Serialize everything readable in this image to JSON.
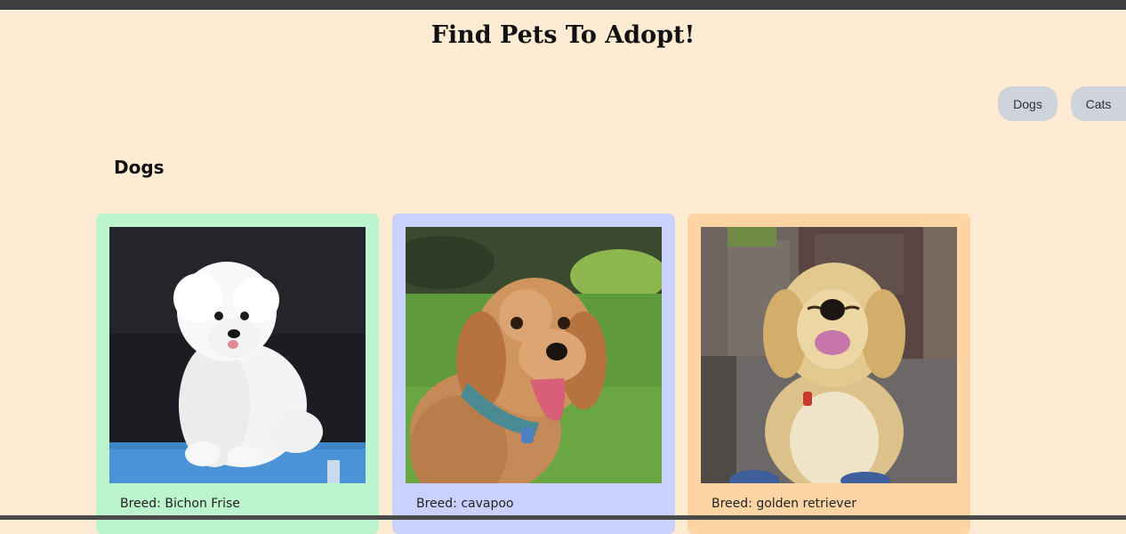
{
  "page": {
    "title": "Find Pets To Adopt!"
  },
  "filters": [
    {
      "label": "Dogs"
    },
    {
      "label": "Cats"
    }
  ],
  "section": {
    "title": "Dogs"
  },
  "pets": [
    {
      "breed_label": "Breed: Bichon Frise",
      "card_color": "#bcf4cd"
    },
    {
      "breed_label": "Breed: cavapoo",
      "card_color": "#cad1fd"
    },
    {
      "breed_label": "Breed: golden retriever",
      "card_color": "#fdd5a5"
    }
  ]
}
